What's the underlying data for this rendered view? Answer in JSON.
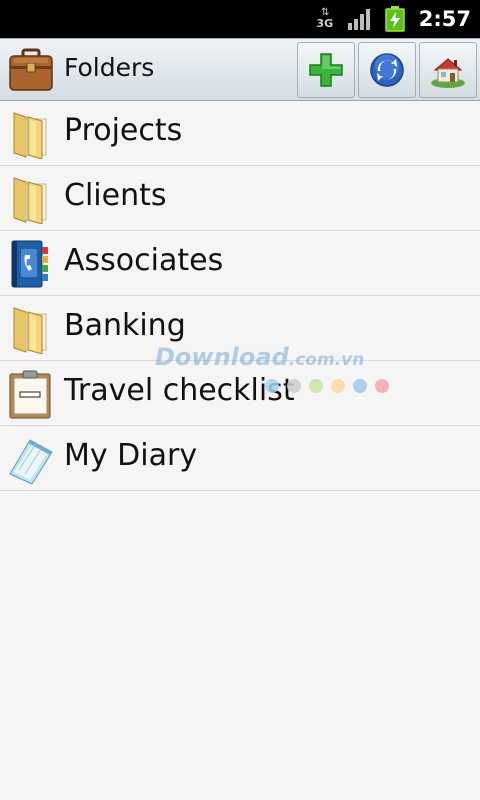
{
  "status_bar": {
    "network_label": "3G",
    "time": "2:57"
  },
  "header": {
    "title": "Folders",
    "actions": [
      {
        "name": "add",
        "icon": "plus-icon"
      },
      {
        "name": "sync",
        "icon": "sync-icon"
      },
      {
        "name": "home",
        "icon": "home-icon"
      }
    ]
  },
  "list": {
    "items": [
      {
        "label": "Projects",
        "icon": "folder-icon"
      },
      {
        "label": "Clients",
        "icon": "folder-icon"
      },
      {
        "label": "Associates",
        "icon": "address-book-icon"
      },
      {
        "label": "Banking",
        "icon": "folder-icon"
      },
      {
        "label": "Travel checklist",
        "icon": "checklist-icon"
      },
      {
        "label": "My Diary",
        "icon": "notepad-icon"
      }
    ]
  },
  "watermark": {
    "brand": "Download",
    "domain": ".com.vn",
    "dot_colors": [
      "#9fd3ef",
      "#cccccc",
      "#c7e3a6",
      "#fdd79d",
      "#9cc8ee",
      "#f4a6ad"
    ]
  },
  "colors": {
    "status_bar_bg": "#000000",
    "title_bar_bg": "#dfe6eb",
    "list_bg": "#f5f5f5",
    "add_green": "#3cb43c",
    "sync_blue": "#2a63c8"
  }
}
